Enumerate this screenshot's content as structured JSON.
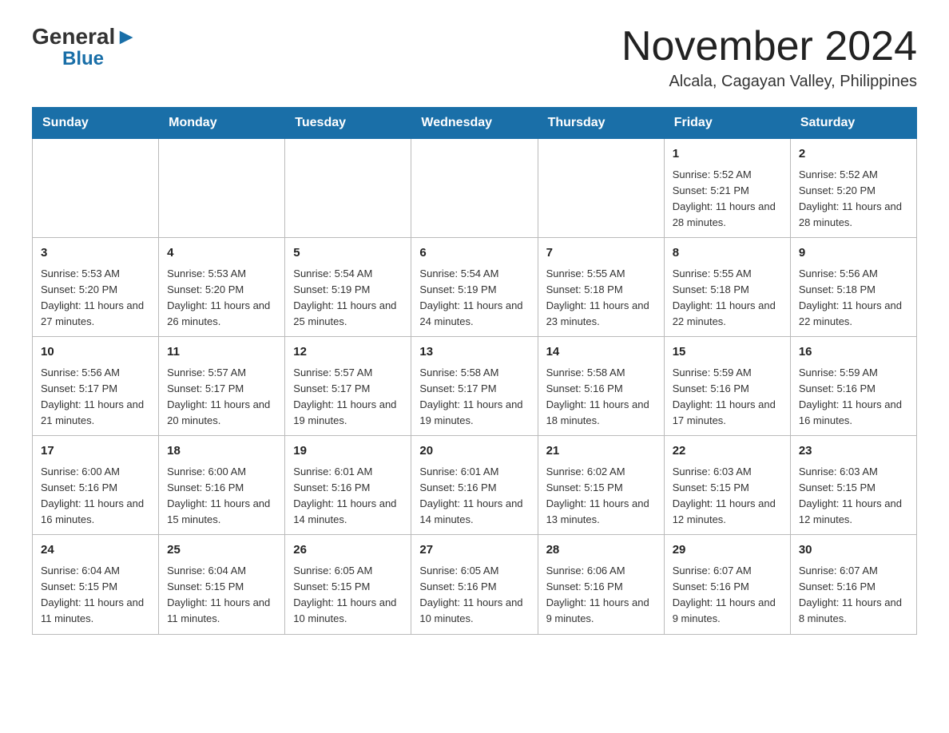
{
  "header": {
    "logo_general": "General",
    "logo_blue": "Blue",
    "title": "November 2024",
    "subtitle": "Alcala, Cagayan Valley, Philippines"
  },
  "calendar": {
    "days_of_week": [
      "Sunday",
      "Monday",
      "Tuesday",
      "Wednesday",
      "Thursday",
      "Friday",
      "Saturday"
    ],
    "weeks": [
      [
        {
          "day": "",
          "info": ""
        },
        {
          "day": "",
          "info": ""
        },
        {
          "day": "",
          "info": ""
        },
        {
          "day": "",
          "info": ""
        },
        {
          "day": "",
          "info": ""
        },
        {
          "day": "1",
          "info": "Sunrise: 5:52 AM\nSunset: 5:21 PM\nDaylight: 11 hours and 28 minutes."
        },
        {
          "day": "2",
          "info": "Sunrise: 5:52 AM\nSunset: 5:20 PM\nDaylight: 11 hours and 28 minutes."
        }
      ],
      [
        {
          "day": "3",
          "info": "Sunrise: 5:53 AM\nSunset: 5:20 PM\nDaylight: 11 hours and 27 minutes."
        },
        {
          "day": "4",
          "info": "Sunrise: 5:53 AM\nSunset: 5:20 PM\nDaylight: 11 hours and 26 minutes."
        },
        {
          "day": "5",
          "info": "Sunrise: 5:54 AM\nSunset: 5:19 PM\nDaylight: 11 hours and 25 minutes."
        },
        {
          "day": "6",
          "info": "Sunrise: 5:54 AM\nSunset: 5:19 PM\nDaylight: 11 hours and 24 minutes."
        },
        {
          "day": "7",
          "info": "Sunrise: 5:55 AM\nSunset: 5:18 PM\nDaylight: 11 hours and 23 minutes."
        },
        {
          "day": "8",
          "info": "Sunrise: 5:55 AM\nSunset: 5:18 PM\nDaylight: 11 hours and 22 minutes."
        },
        {
          "day": "9",
          "info": "Sunrise: 5:56 AM\nSunset: 5:18 PM\nDaylight: 11 hours and 22 minutes."
        }
      ],
      [
        {
          "day": "10",
          "info": "Sunrise: 5:56 AM\nSunset: 5:17 PM\nDaylight: 11 hours and 21 minutes."
        },
        {
          "day": "11",
          "info": "Sunrise: 5:57 AM\nSunset: 5:17 PM\nDaylight: 11 hours and 20 minutes."
        },
        {
          "day": "12",
          "info": "Sunrise: 5:57 AM\nSunset: 5:17 PM\nDaylight: 11 hours and 19 minutes."
        },
        {
          "day": "13",
          "info": "Sunrise: 5:58 AM\nSunset: 5:17 PM\nDaylight: 11 hours and 19 minutes."
        },
        {
          "day": "14",
          "info": "Sunrise: 5:58 AM\nSunset: 5:16 PM\nDaylight: 11 hours and 18 minutes."
        },
        {
          "day": "15",
          "info": "Sunrise: 5:59 AM\nSunset: 5:16 PM\nDaylight: 11 hours and 17 minutes."
        },
        {
          "day": "16",
          "info": "Sunrise: 5:59 AM\nSunset: 5:16 PM\nDaylight: 11 hours and 16 minutes."
        }
      ],
      [
        {
          "day": "17",
          "info": "Sunrise: 6:00 AM\nSunset: 5:16 PM\nDaylight: 11 hours and 16 minutes."
        },
        {
          "day": "18",
          "info": "Sunrise: 6:00 AM\nSunset: 5:16 PM\nDaylight: 11 hours and 15 minutes."
        },
        {
          "day": "19",
          "info": "Sunrise: 6:01 AM\nSunset: 5:16 PM\nDaylight: 11 hours and 14 minutes."
        },
        {
          "day": "20",
          "info": "Sunrise: 6:01 AM\nSunset: 5:16 PM\nDaylight: 11 hours and 14 minutes."
        },
        {
          "day": "21",
          "info": "Sunrise: 6:02 AM\nSunset: 5:15 PM\nDaylight: 11 hours and 13 minutes."
        },
        {
          "day": "22",
          "info": "Sunrise: 6:03 AM\nSunset: 5:15 PM\nDaylight: 11 hours and 12 minutes."
        },
        {
          "day": "23",
          "info": "Sunrise: 6:03 AM\nSunset: 5:15 PM\nDaylight: 11 hours and 12 minutes."
        }
      ],
      [
        {
          "day": "24",
          "info": "Sunrise: 6:04 AM\nSunset: 5:15 PM\nDaylight: 11 hours and 11 minutes."
        },
        {
          "day": "25",
          "info": "Sunrise: 6:04 AM\nSunset: 5:15 PM\nDaylight: 11 hours and 11 minutes."
        },
        {
          "day": "26",
          "info": "Sunrise: 6:05 AM\nSunset: 5:15 PM\nDaylight: 11 hours and 10 minutes."
        },
        {
          "day": "27",
          "info": "Sunrise: 6:05 AM\nSunset: 5:16 PM\nDaylight: 11 hours and 10 minutes."
        },
        {
          "day": "28",
          "info": "Sunrise: 6:06 AM\nSunset: 5:16 PM\nDaylight: 11 hours and 9 minutes."
        },
        {
          "day": "29",
          "info": "Sunrise: 6:07 AM\nSunset: 5:16 PM\nDaylight: 11 hours and 9 minutes."
        },
        {
          "day": "30",
          "info": "Sunrise: 6:07 AM\nSunset: 5:16 PM\nDaylight: 11 hours and 8 minutes."
        }
      ]
    ]
  }
}
